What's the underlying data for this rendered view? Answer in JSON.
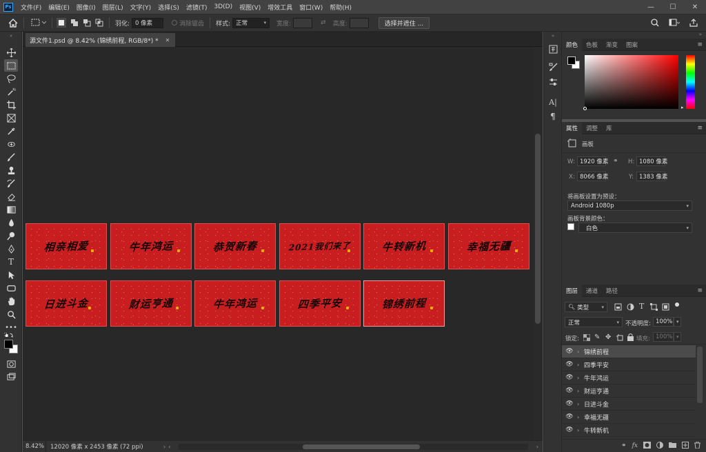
{
  "app": {
    "logo": "Ps"
  },
  "menu": [
    "文件(F)",
    "编辑(E)",
    "图像(I)",
    "图层(L)",
    "文字(Y)",
    "选择(S)",
    "滤镜(T)",
    "3D(D)",
    "视图(V)",
    "增效工具",
    "窗口(W)",
    "帮助(H)"
  ],
  "window_controls": {
    "minimize": "—",
    "maximize": "☐",
    "close": "✕"
  },
  "options": {
    "feather_label": "羽化:",
    "feather_value": "0 像素",
    "antialias_label": "消除锯齿",
    "style_label": "样式:",
    "style_value": "正常",
    "width_label": "宽度:",
    "height_label": "高度:",
    "select_mask_button": "选择并遮住 ..."
  },
  "document": {
    "tab_title": "源文件1.psd @ 8.42% (锦绣前程, RGB/8*) *",
    "close": "✕"
  },
  "artboards": {
    "row1": [
      "相亲相爱",
      "牛年鸿运",
      "恭贺新春",
      "2021我们来了",
      "牛转新机",
      "幸福无疆"
    ],
    "row2": [
      "日进斗金",
      "财运亨通",
      "牛年鸿运",
      "四季平安",
      "锦绣前程"
    ]
  },
  "status": {
    "zoom": "8.42%",
    "info": "12020 像素 x 2453 像素 (72 ppi)"
  },
  "color_panel": {
    "tabs": [
      "颜色",
      "色板",
      "渐变",
      "图案"
    ],
    "accent": "#ff0000"
  },
  "properties_panel": {
    "tabs": [
      "属性",
      "调整",
      "库"
    ],
    "type_label": "画板",
    "w_label": "W:",
    "w_value": "1920 像素",
    "h_label": "H:",
    "h_value": "1080 像素",
    "x_label": "X:",
    "x_value": "8066 像素",
    "y_label": "Y:",
    "y_value": "1383 像素",
    "preset_label": "将画板设置为预设：",
    "preset_value": "Android 1080p",
    "bg_label": "画板背景颜色：",
    "bg_value": "白色"
  },
  "layers_panel": {
    "tabs": [
      "图层",
      "通道",
      "路径"
    ],
    "filter_label": "类型",
    "blend_mode": "正常",
    "opacity_label": "不透明度:",
    "opacity_value": "100%",
    "lock_label": "锁定:",
    "fill_label": "填充:",
    "fill_value": "100%",
    "layers": [
      "锦绣前程",
      "四季平安",
      "牛年鸿运",
      "财运亨通",
      "日进斗金",
      "幸福无疆",
      "牛转新机"
    ]
  },
  "colors": {
    "card_red": "#c81e20",
    "panel_bg": "#323232",
    "canvas_bg": "#282828"
  }
}
